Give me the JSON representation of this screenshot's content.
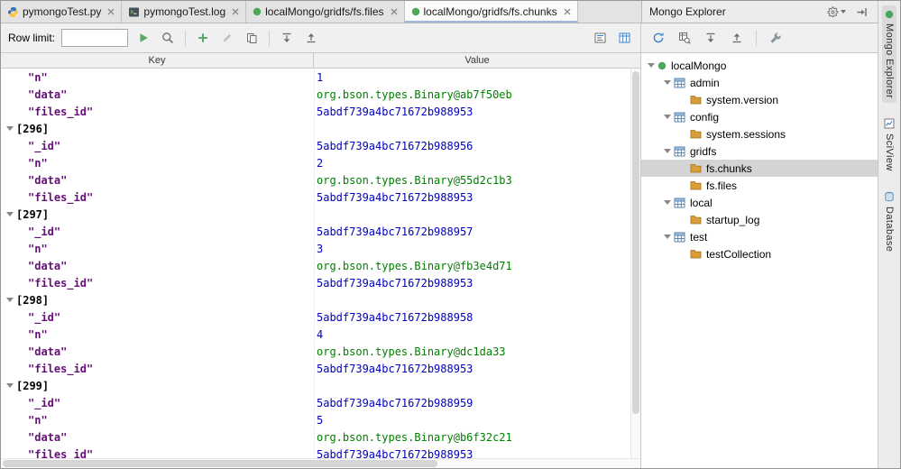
{
  "editor_tabs": [
    {
      "label": "pymongoTest.py",
      "icon": "python-file-icon",
      "active": false
    },
    {
      "label": "pymongoTest.log",
      "icon": "log-file-icon",
      "active": false
    },
    {
      "label": "localMongo/gridfs/fs.files",
      "icon": "mongo-collection-icon",
      "active": false
    },
    {
      "label": "localMongo/gridfs/fs.chunks",
      "icon": "mongo-collection-icon",
      "active": true
    }
  ],
  "left_toolbar": {
    "row_limit_label": "Row limit:",
    "row_limit_value": ""
  },
  "grid": {
    "columns": [
      "Key",
      "Value"
    ],
    "rows": [
      {
        "key": "\"n\"",
        "value": "1",
        "kind": "number"
      },
      {
        "key": "\"data\"",
        "value": "org.bson.types.Binary@ab7f50eb",
        "kind": "binary"
      },
      {
        "key": "\"files_id\"",
        "value": "5abdf739a4bc71672b988953",
        "kind": "id"
      },
      {
        "key": "[296]",
        "value": "",
        "kind": "index"
      },
      {
        "key": "\"_id\"",
        "value": "5abdf739a4bc71672b988956",
        "kind": "id"
      },
      {
        "key": "\"n\"",
        "value": "2",
        "kind": "number"
      },
      {
        "key": "\"data\"",
        "value": "org.bson.types.Binary@55d2c1b3",
        "kind": "binary"
      },
      {
        "key": "\"files_id\"",
        "value": "5abdf739a4bc71672b988953",
        "kind": "id"
      },
      {
        "key": "[297]",
        "value": "",
        "kind": "index"
      },
      {
        "key": "\"_id\"",
        "value": "5abdf739a4bc71672b988957",
        "kind": "id"
      },
      {
        "key": "\"n\"",
        "value": "3",
        "kind": "number"
      },
      {
        "key": "\"data\"",
        "value": "org.bson.types.Binary@fb3e4d71",
        "kind": "binary"
      },
      {
        "key": "\"files_id\"",
        "value": "5abdf739a4bc71672b988953",
        "kind": "id"
      },
      {
        "key": "[298]",
        "value": "",
        "kind": "index"
      },
      {
        "key": "\"_id\"",
        "value": "5abdf739a4bc71672b988958",
        "kind": "id"
      },
      {
        "key": "\"n\"",
        "value": "4",
        "kind": "number"
      },
      {
        "key": "\"data\"",
        "value": "org.bson.types.Binary@dc1da33",
        "kind": "binary"
      },
      {
        "key": "\"files_id\"",
        "value": "5abdf739a4bc71672b988953",
        "kind": "id"
      },
      {
        "key": "[299]",
        "value": "",
        "kind": "index"
      },
      {
        "key": "\"_id\"",
        "value": "5abdf739a4bc71672b988959",
        "kind": "id"
      },
      {
        "key": "\"n\"",
        "value": "5",
        "kind": "number"
      },
      {
        "key": "\"data\"",
        "value": "org.bson.types.Binary@b6f32c21",
        "kind": "binary"
      },
      {
        "key": "\"files_id\"",
        "value": "5abdf739a4bc71672b988953",
        "kind": "id"
      }
    ]
  },
  "explorer": {
    "title": "Mongo Explorer",
    "tree": [
      {
        "label": "localMongo",
        "level": 0,
        "icon": "mongo-server-icon",
        "expanded": true,
        "selected": false
      },
      {
        "label": "admin",
        "level": 1,
        "icon": "database-table-icon",
        "expanded": true,
        "selected": false
      },
      {
        "label": "system.version",
        "level": 2,
        "icon": "collection-folder-icon",
        "expanded": false,
        "selected": false
      },
      {
        "label": "config",
        "level": 1,
        "icon": "database-table-icon",
        "expanded": true,
        "selected": false
      },
      {
        "label": "system.sessions",
        "level": 2,
        "icon": "collection-folder-icon",
        "expanded": false,
        "selected": false
      },
      {
        "label": "gridfs",
        "level": 1,
        "icon": "database-table-icon",
        "expanded": true,
        "selected": false
      },
      {
        "label": "fs.chunks",
        "level": 2,
        "icon": "collection-folder-icon",
        "expanded": false,
        "selected": true
      },
      {
        "label": "fs.files",
        "level": 2,
        "icon": "collection-folder-icon",
        "expanded": false,
        "selected": false
      },
      {
        "label": "local",
        "level": 1,
        "icon": "database-table-icon",
        "expanded": true,
        "selected": false
      },
      {
        "label": "startup_log",
        "level": 2,
        "icon": "collection-folder-icon",
        "expanded": false,
        "selected": false
      },
      {
        "label": "test",
        "level": 1,
        "icon": "database-table-icon",
        "expanded": true,
        "selected": false
      },
      {
        "label": "testCollection",
        "level": 2,
        "icon": "collection-folder-icon",
        "expanded": false,
        "selected": false
      }
    ]
  },
  "tool_window_bar": {
    "tabs": [
      "Mongo Explorer",
      "SciView",
      "Database"
    ]
  },
  "colors": {
    "key": "#660E7A",
    "number": "#0000C0",
    "binary": "#007F00",
    "selection": "#D4D4D4",
    "accent_green": "#59A869"
  }
}
